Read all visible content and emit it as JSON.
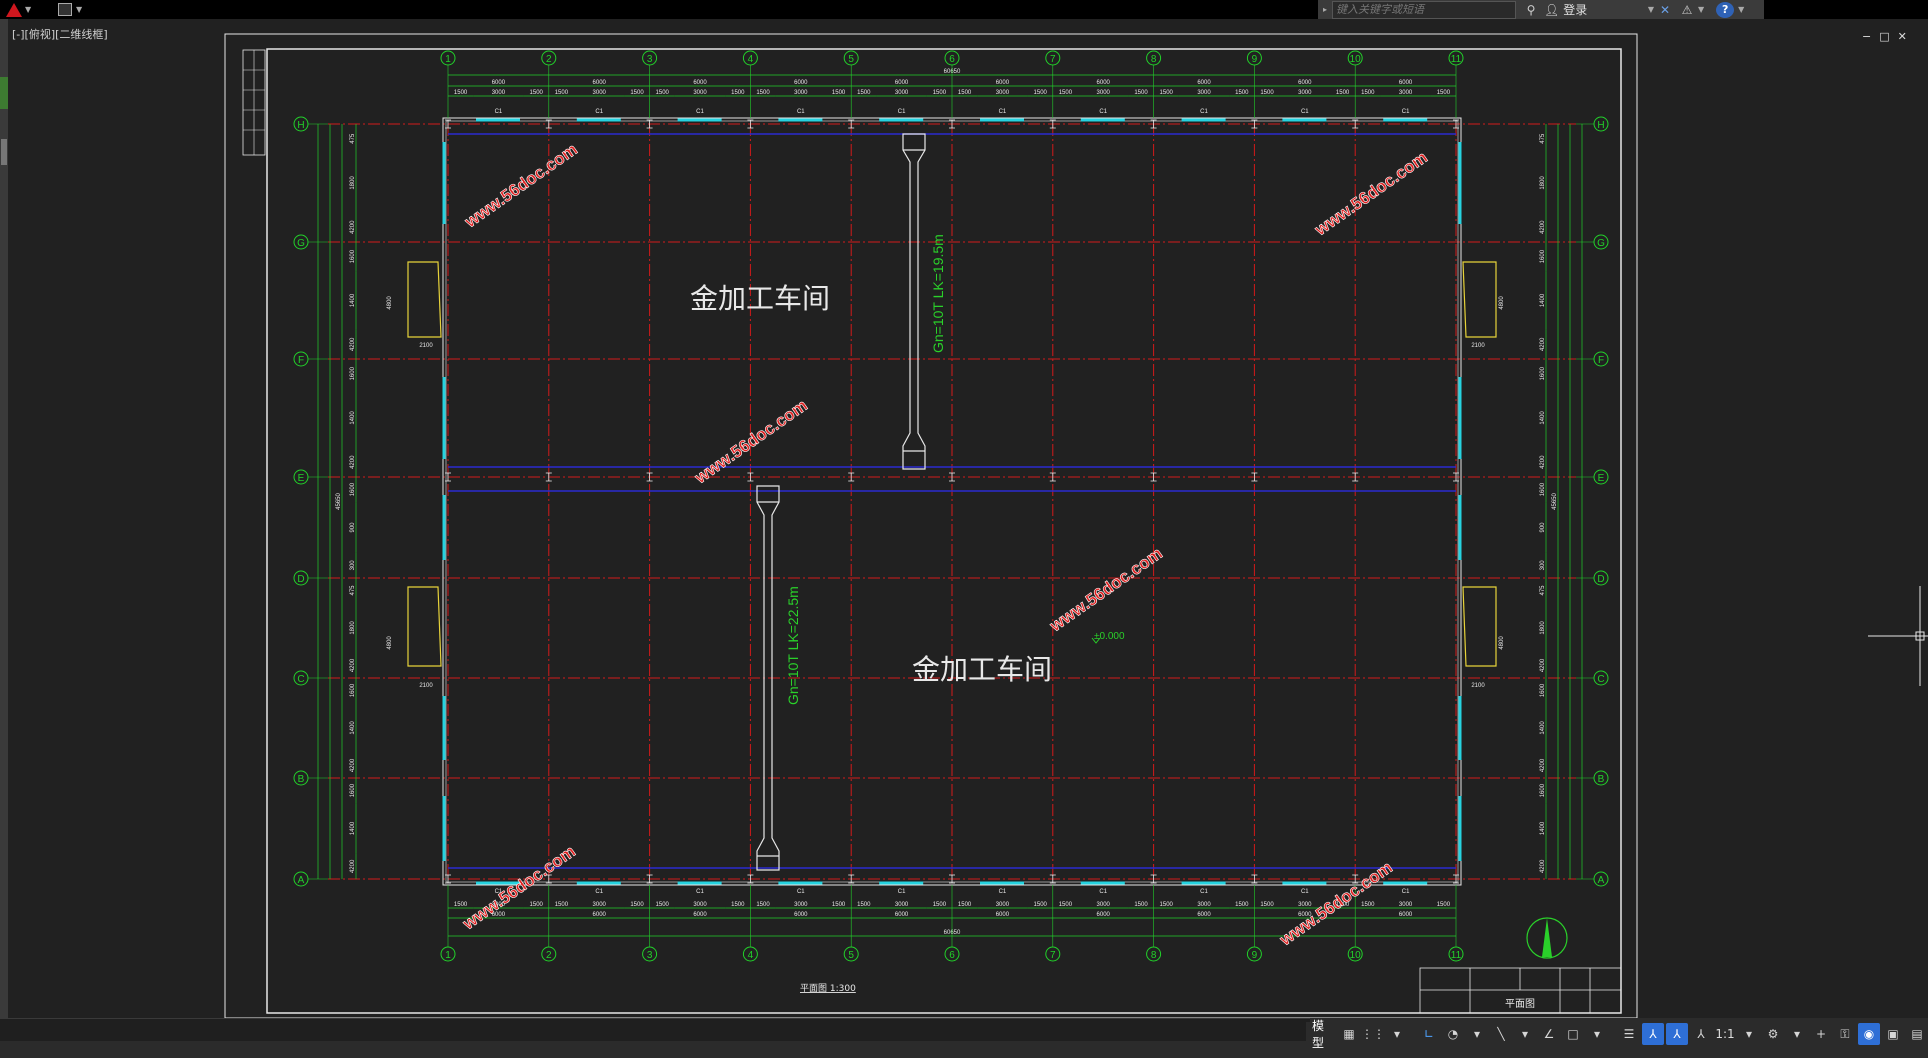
{
  "titlebar": {
    "search_placeholder": "键入关键字或短语",
    "signin_label": "登录"
  },
  "viewport": {
    "controls_label": "[-][俯视][二维线框]"
  },
  "window_controls": [
    "−",
    "□",
    "✕"
  ],
  "drawing": {
    "column_labels": [
      "1",
      "2",
      "3",
      "4",
      "5",
      "6",
      "7",
      "8",
      "9",
      "10",
      "11"
    ],
    "row_labels": [
      "H",
      "G",
      "F",
      "E",
      "D",
      "C",
      "B",
      "A"
    ],
    "total_width_dim": "60650",
    "top_spans": [
      "6000",
      "6000",
      "6000",
      "6000",
      "6000",
      "6000",
      "6000",
      "6000",
      "6000",
      "6000"
    ],
    "sub_dims": [
      "1500",
      "3000",
      "1500"
    ],
    "window_tag": "C1",
    "room_label_upper": "金加工车间",
    "room_label_lower": "金加工车间",
    "crane_upper": "Gn=10T  LK=19.5m",
    "crane_lower": "Gn=10T  LK=22.5m",
    "elevation": "±0.000",
    "plan_caption": "平面图 1:300",
    "title_block_name": "平面图",
    "door_dim": "2100",
    "door_height": "4800",
    "watermark": "www.56doc.com",
    "left_total": "45650",
    "side_dims": [
      "475",
      "1800",
      "4200",
      "1600",
      "1400",
      "4200",
      "1600",
      "1400",
      "4200",
      "1600",
      "900",
      "300"
    ]
  },
  "statusbar": {
    "model_tab": "模型",
    "scale": "1:1"
  },
  "colors": {
    "grid_red": "#d21a1a",
    "dim_green": "#22d12a",
    "wall_cyan": "#26d3e0",
    "beam_blue": "#2b2bd0",
    "watermark_red": "#e02020",
    "background": "#212121"
  }
}
